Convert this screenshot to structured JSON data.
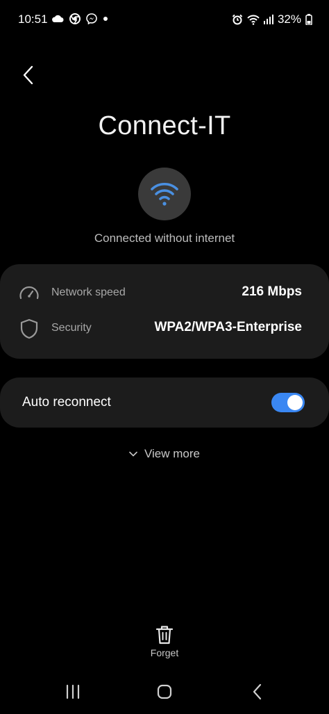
{
  "status_bar": {
    "time": "10:51",
    "left_icons": [
      "cloud-icon",
      "chrome-icon",
      "messenger-icon",
      "dot-icon"
    ],
    "right_icons": [
      "alarm-icon",
      "wifi-signal-icon",
      "cell-signal-icon"
    ],
    "battery": "32%"
  },
  "header": {
    "back_icon": "chevron-left-icon",
    "title": "Connect-IT"
  },
  "network": {
    "icon": "wifi-icon",
    "status": "Connected without internet",
    "accent": "#4a90e2"
  },
  "details": [
    {
      "icon": "speedometer-icon",
      "label": "Network speed",
      "value": "216 Mbps"
    },
    {
      "icon": "shield-icon",
      "label": "Security",
      "value": "WPA2/WPA3-Enterprise"
    }
  ],
  "auto_reconnect": {
    "label": "Auto reconnect",
    "enabled": true,
    "toggle_color": "#3a87f2"
  },
  "view_more": {
    "label": "View more",
    "icon": "chevron-down-icon"
  },
  "forget": {
    "icon": "trash-icon",
    "label": "Forget"
  },
  "nav_bar": {
    "buttons": [
      "recents-icon",
      "home-icon",
      "back-icon"
    ]
  }
}
